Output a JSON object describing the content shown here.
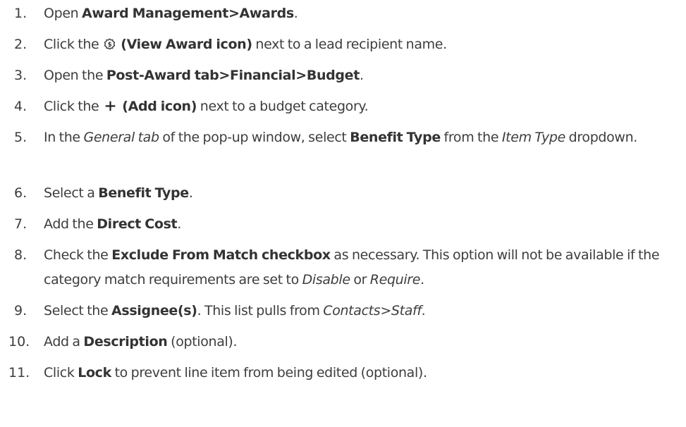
{
  "steps": [
    {
      "number": "1.",
      "parts": {
        "a": "Open ",
        "b": "Award Management>Awards",
        "c": "."
      }
    },
    {
      "number": "2.",
      "parts": {
        "a": "Click the ",
        "icon": "view-award-icon",
        "b": " (View Award icon)",
        "c": " next to a lead recipient name."
      }
    },
    {
      "number": "3.",
      "parts": {
        "a": "Open the ",
        "b": "Post-Award tab>Financial>Budget",
        "c": "."
      }
    },
    {
      "number": "4.",
      "parts": {
        "a": "Click the ",
        "icon": "add-icon",
        "b": " (Add icon)",
        "c": " next to a budget category."
      }
    },
    {
      "number": "5.",
      "parts": {
        "a": "In the ",
        "b": "General tab",
        "c": " of the pop-up window, select ",
        "d": "Benefit Type",
        "e": " from the ",
        "f": "Item Type",
        "g": " dropdown."
      }
    },
    {
      "number": "6.",
      "parts": {
        "a": "Select a ",
        "b": "Benefit Type",
        "c": "."
      }
    },
    {
      "number": "7.",
      "parts": {
        "a": "Add the ",
        "b": "Direct Cost",
        "c": "."
      }
    },
    {
      "number": "8.",
      "parts": {
        "a": "Check the ",
        "b": "Exclude From Match checkbox",
        "c": " as necessary. This option will not be available if the category match requirements are set to ",
        "d": "Disable",
        "e": " or ",
        "f": "Require",
        "g": "."
      }
    },
    {
      "number": "9.",
      "parts": {
        "a": "Select the ",
        "b": "Assignee(s)",
        "c": ". This list pulls from ",
        "d": "Contacts>Staff",
        "e": "."
      }
    },
    {
      "number": "10.",
      "parts": {
        "a": "Add a ",
        "b": "Description",
        "c": " (optional)."
      }
    },
    {
      "number": "11.",
      "parts": {
        "a": "Click ",
        "b": "Lock",
        "c": " to prevent line item from being edited (optional)."
      }
    }
  ]
}
